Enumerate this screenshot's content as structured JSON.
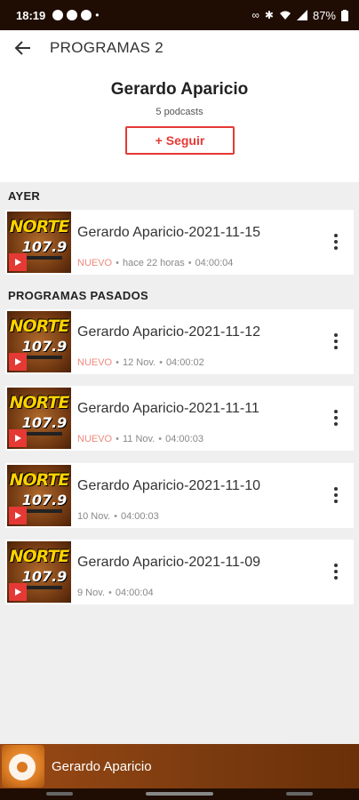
{
  "status_bar": {
    "time": "18:19",
    "battery": "87%",
    "icons_left": [
      "notification-icon",
      "notification-icon",
      "notification-icon"
    ],
    "icons_right": [
      "voicemail-icon",
      "bluetooth-icon",
      "wifi-icon",
      "signal-icon",
      "battery-icon"
    ]
  },
  "app_bar": {
    "title": "PROGRAMAS 2",
    "back_icon": "arrow-left-icon"
  },
  "podcast": {
    "title": "Gerardo Aparicio",
    "count": "5 podcasts",
    "follow_label": "+ Seguir"
  },
  "sections": [
    {
      "label": "AYER",
      "episodes": [
        {
          "title": "Gerardo Aparicio-2021-11-15",
          "badge": "NUEVO",
          "date": "hace 22 horas",
          "duration": "04:00:04"
        }
      ]
    },
    {
      "label": "PROGRAMAS PASADOS",
      "episodes": [
        {
          "title": "Gerardo Aparicio-2021-11-12",
          "badge": "NUEVO",
          "date": "12 Nov.",
          "duration": "04:00:02"
        },
        {
          "title": "Gerardo Aparicio-2021-11-11",
          "badge": "NUEVO",
          "date": "11 Nov.",
          "duration": "04:00:03"
        },
        {
          "title": "Gerardo Aparicio-2021-11-10",
          "badge": "",
          "date": "10 Nov.",
          "duration": "04:00:03"
        },
        {
          "title": "Gerardo Aparicio-2021-11-09",
          "badge": "",
          "date": "9 Nov.",
          "duration": "04:00:04"
        }
      ]
    }
  ],
  "thumbnail": {
    "logo_top": "NORTE",
    "logo_freq": "107.9"
  },
  "mini_player": {
    "title": "Gerardo Aparicio"
  },
  "colors": {
    "accent": "#e53935",
    "brand_brown": "#7a3a0f",
    "nuevo": "#f08a7e"
  }
}
